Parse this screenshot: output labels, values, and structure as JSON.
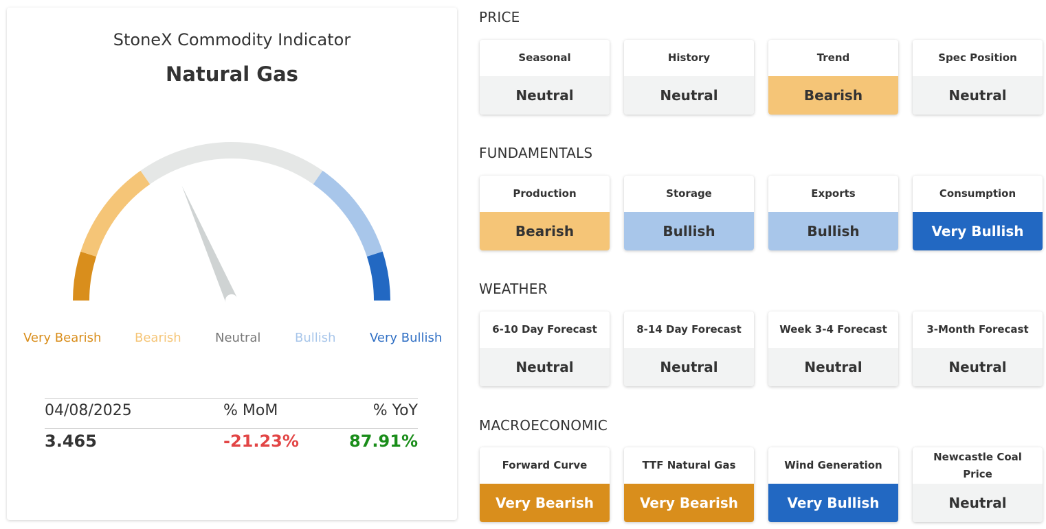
{
  "gauge_card": {
    "title": "StoneX Commodity Indicator",
    "commodity": "Natural Gas",
    "zone_labels": {
      "very_bearish": "Very Bearish",
      "bearish": "Bearish",
      "neutral": "Neutral",
      "bullish": "Bullish",
      "very_bullish": "Very Bullish"
    },
    "needle_value": 0.37,
    "stats": {
      "date": "04/08/2025",
      "mom_label": "% MoM",
      "yoy_label": "% YoY",
      "price": "3.465",
      "mom_value": "-21.23%",
      "yoy_value": "87.91%"
    }
  },
  "colors": {
    "very_bearish": "#d98e1c",
    "bearish": "#f5c577",
    "neutral": "#f2f3f3",
    "neutral_arc": "#e5e7e6",
    "bullish": "#a8c6ea",
    "very_bullish": "#2268c2",
    "negative": "#e24545",
    "positive": "#1a8d1a",
    "needle": "#cfd3d3"
  },
  "sections": {
    "price": {
      "title": "PRICE",
      "tiles": [
        {
          "label": "Seasonal",
          "status": "Neutral"
        },
        {
          "label": "History",
          "status": "Neutral"
        },
        {
          "label": "Trend",
          "status": "Bearish"
        },
        {
          "label": "Spec Position",
          "status": "Neutral"
        }
      ]
    },
    "fundamentals": {
      "title": "FUNDAMENTALS",
      "tiles": [
        {
          "label": "Production",
          "status": "Bearish"
        },
        {
          "label": "Storage",
          "status": "Bullish"
        },
        {
          "label": "Exports",
          "status": "Bullish"
        },
        {
          "label": "Consumption",
          "status": "Very Bullish"
        }
      ]
    },
    "weather": {
      "title": "WEATHER",
      "tiles": [
        {
          "label": "6-10 Day Forecast",
          "status": "Neutral"
        },
        {
          "label": "8-14 Day Forecast",
          "status": "Neutral"
        },
        {
          "label": "Week 3-4 Forecast",
          "status": "Neutral"
        },
        {
          "label": "3-Month Forecast",
          "status": "Neutral"
        }
      ]
    },
    "macroeconomic": {
      "title": "MACROECONOMIC",
      "tiles": [
        {
          "label": "Forward Curve",
          "status": "Very Bearish"
        },
        {
          "label": "TTF Natural Gas",
          "status": "Very Bearish"
        },
        {
          "label": "Wind Generation",
          "status": "Very Bullish"
        },
        {
          "label": "Newcastle Coal Price",
          "status": "Neutral"
        }
      ]
    }
  }
}
